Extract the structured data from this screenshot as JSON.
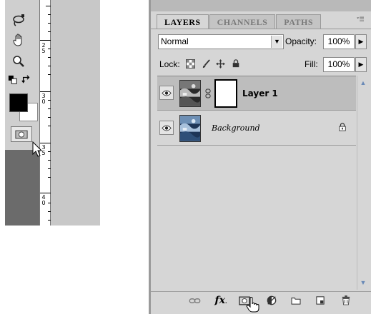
{
  "toolbox": {
    "tools": [
      {
        "icon": "lasso-icon"
      },
      {
        "icon": "hand-icon"
      },
      {
        "icon": "zoom-icon"
      },
      {
        "icon": "default-colors-icon"
      },
      {
        "icon": "swap-colors-icon"
      }
    ],
    "foreground_color": "#000000",
    "background_color": "#ffffff",
    "quick_mask_icon": "quick-mask-icon"
  },
  "ruler": {
    "numbers": [
      "2\n5",
      "3\n0",
      "3\n5",
      "4\n0"
    ]
  },
  "panel": {
    "tabs": [
      {
        "label": "LAYERS",
        "active": true
      },
      {
        "label": "CHANNELS",
        "active": false
      },
      {
        "label": "PATHS",
        "active": false
      }
    ],
    "blend_mode": "Normal",
    "opacity_label": "Opacity:",
    "opacity_value": "100%",
    "lock_label": "Lock:",
    "fill_label": "Fill:",
    "fill_value": "100%",
    "layers": [
      {
        "name": "Layer 1",
        "has_mask": true,
        "selected": true,
        "visible": true
      },
      {
        "name": "Background",
        "locked": true,
        "selected": false,
        "visible": true
      }
    ],
    "bottom_icons": [
      "link-icon",
      "fx-icon",
      "add-mask-icon",
      "adjustment-icon",
      "new-group-icon",
      "new-layer-icon",
      "trash-icon"
    ],
    "fx_label": "fx"
  },
  "colors": {
    "panel_bg": "#d6d6d6",
    "selected_row": "#bdbdbd",
    "toolbox_bg": "#cfcfcf"
  }
}
